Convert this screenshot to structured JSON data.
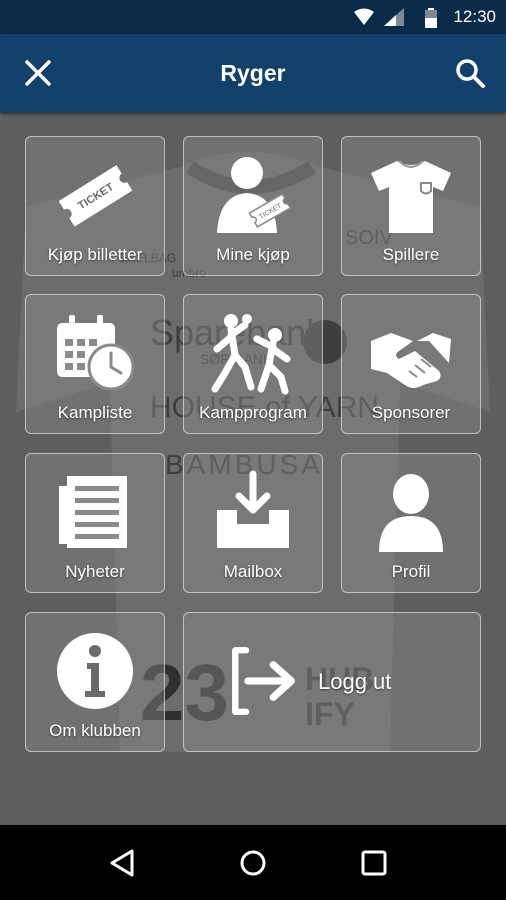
{
  "status_bar": {
    "time": "12:30",
    "icons": [
      "wifi-icon",
      "signal-icon",
      "battery-icon"
    ]
  },
  "app_bar": {
    "title": "Ryger",
    "close_icon": "close-icon",
    "search_icon": "search-icon"
  },
  "background": {
    "description_text": [
      "Sparebank",
      "SØR BANK",
      "HOUSE of YARN",
      "BAMBUSA",
      "23",
      "HUB",
      "IFY",
      "SOIV",
      "umbro",
      "EKELBAG"
    ]
  },
  "tiles": [
    {
      "label": "Kjøp billetter",
      "icon": "ticket-icon",
      "ticket_text": "TICKET"
    },
    {
      "label": "Mine kjøp",
      "icon": "person-ticket-icon",
      "ticket_text": "TICKET"
    },
    {
      "label": "Spillere",
      "icon": "jersey-icon"
    },
    {
      "label": "Kampliste",
      "icon": "calendar-clock-icon"
    },
    {
      "label": "Kampprogram",
      "icon": "handball-players-icon"
    },
    {
      "label": "Sponsorer",
      "icon": "handshake-icon"
    },
    {
      "label": "Nyheter",
      "icon": "newspaper-icon"
    },
    {
      "label": "Mailbox",
      "icon": "inbox-download-icon"
    },
    {
      "label": "Profil",
      "icon": "profile-icon"
    },
    {
      "label": "Om klubben",
      "icon": "info-icon"
    },
    {
      "label": "Logg ut",
      "icon": "logout-icon"
    }
  ],
  "nav_bar": {
    "back": "back-icon",
    "home": "home-icon",
    "recents": "recents-icon"
  },
  "colors": {
    "status_bar": "#0a2a4a",
    "app_bar": "#11406b",
    "content_bg": "#5e5e5e",
    "tile_border": "#ffffff"
  }
}
